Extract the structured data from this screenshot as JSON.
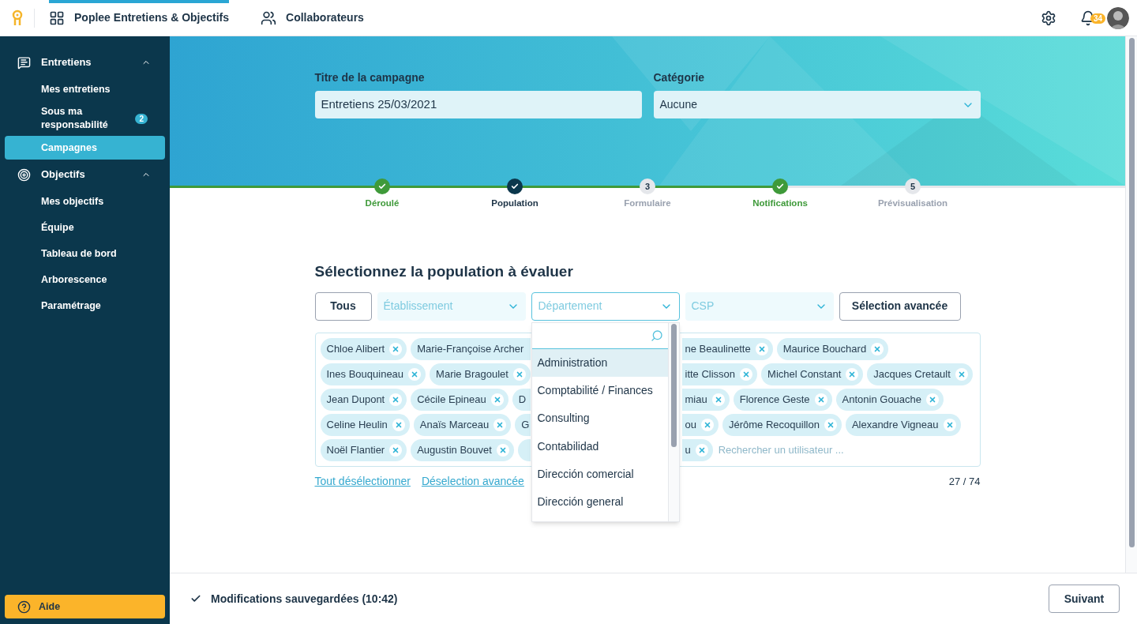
{
  "topbar": {
    "nav": [
      {
        "label": "Poplee Entretiens & Objectifs",
        "selected": true
      },
      {
        "label": "Collaborateurs",
        "selected": false
      }
    ],
    "notifications": "34"
  },
  "sidebar": {
    "sections": [
      {
        "label": "Entretiens",
        "expanded": true,
        "items": [
          {
            "label": "Mes entretiens",
            "selected": false
          },
          {
            "label": "Sous ma responsabilité",
            "selected": false,
            "badge": "2"
          },
          {
            "label": "Campagnes",
            "selected": true
          }
        ]
      },
      {
        "label": "Objectifs",
        "expanded": true,
        "items": [
          {
            "label": "Mes objectifs",
            "selected": false
          },
          {
            "label": "Équipe",
            "selected": false
          },
          {
            "label": "Tableau de bord",
            "selected": false
          },
          {
            "label": "Arborescence",
            "selected": false
          },
          {
            "label": "Paramétrage",
            "selected": false
          }
        ]
      }
    ],
    "help": "Aide"
  },
  "campaign": {
    "title_label": "Titre de la campagne",
    "title_value": "Entretiens 25/03/2021",
    "category_label": "Catégorie",
    "category_value": "Aucune"
  },
  "steps": [
    {
      "label": "Déroulé",
      "done": true,
      "current": false
    },
    {
      "label": "Population",
      "done": true,
      "current": true
    },
    {
      "label": "Formulaire",
      "done": false,
      "current": false,
      "number": "3"
    },
    {
      "label": "Notifications",
      "done": true,
      "current": false
    },
    {
      "label": "Prévisualisation",
      "done": false,
      "current": false,
      "number": "5"
    }
  ],
  "population": {
    "heading": "Sélectionnez la population à évaluer",
    "filters": [
      {
        "kind": "button",
        "label": "Tous"
      },
      {
        "kind": "select",
        "placeholder": "Établissement",
        "focused": false
      },
      {
        "kind": "select",
        "placeholder": "Département",
        "focused": true
      },
      {
        "kind": "select",
        "placeholder": "CSP",
        "focused": false
      },
      {
        "kind": "button",
        "label": "Sélection avancée"
      }
    ],
    "rows": [
      {
        "left": [
          {
            "text": "Chloe Alibert",
            "kind": "full"
          },
          {
            "text": "Marie-Françoise Archer",
            "kind": "cut_end"
          }
        ],
        "right": [
          {
            "text": "ne Beaulinette",
            "kind": "cut_start"
          },
          {
            "text": "Maurice Bouchard",
            "kind": "full"
          }
        ]
      },
      {
        "left": [
          {
            "text": "Ines Bouquineau",
            "kind": "full"
          },
          {
            "text": "Marie Bragoulet",
            "kind": "full"
          }
        ],
        "right": [
          {
            "text": "itte Clisson",
            "kind": "cut_start"
          },
          {
            "text": "Michel Constant",
            "kind": "full"
          },
          {
            "text": "Jacques Cretault",
            "kind": "full"
          }
        ]
      },
      {
        "left": [
          {
            "text": "Jean Dupont",
            "kind": "full"
          },
          {
            "text": "Cécile Epineau",
            "kind": "full"
          },
          {
            "text": "D",
            "kind": "cut_end"
          }
        ],
        "right": [
          {
            "text": "miau",
            "kind": "cut_start"
          },
          {
            "text": "Florence Geste",
            "kind": "full"
          },
          {
            "text": "Antonin Gouache",
            "kind": "full"
          }
        ]
      },
      {
        "left": [
          {
            "text": "Celine Heulin",
            "kind": "full"
          },
          {
            "text": "Anaïs Marceau",
            "kind": "full"
          },
          {
            "text": "G",
            "kind": "cut_end"
          }
        ],
        "right": [
          {
            "text": "ou",
            "kind": "cut_start"
          },
          {
            "text": "Jérôme Recoquillon",
            "kind": "full"
          },
          {
            "text": "Alexandre Vigneau",
            "kind": "full"
          }
        ]
      },
      {
        "left": [
          {
            "text": "Noël Flantier",
            "kind": "full"
          },
          {
            "text": "Augustin Bouvet",
            "kind": "full"
          },
          {
            "kind": "cut_end"
          }
        ],
        "right": [
          {
            "text": "u",
            "kind": "cut_start"
          }
        ]
      }
    ],
    "search_placeholder": "Rechercher un utilisateur ...",
    "links": [
      "Tout désélectionner",
      "Déselection avancée"
    ],
    "count": "27 / 74",
    "dropdown": [
      {
        "label": "Administration",
        "highlighted": true
      },
      {
        "label": "Comptabilité / Finances",
        "highlighted": false
      },
      {
        "label": "Consulting",
        "highlighted": false
      },
      {
        "label": "Contabilidad",
        "highlighted": false
      },
      {
        "label": "Dirección comercial",
        "highlighted": false
      },
      {
        "label": "Dirección general",
        "highlighted": false
      }
    ]
  },
  "footer": {
    "status": "Modifications sauvegardées (10:42)",
    "next": "Suivant"
  }
}
